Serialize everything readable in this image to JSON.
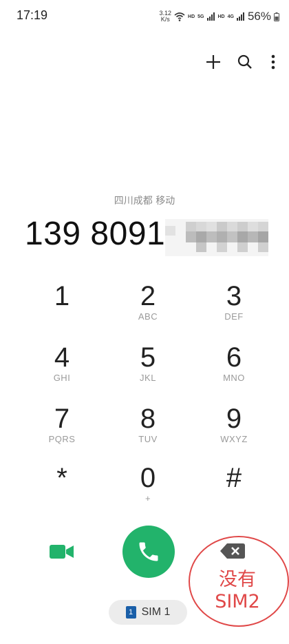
{
  "status_bar": {
    "time": "17:19",
    "speed_value": "3.12",
    "speed_unit": "K/s",
    "hd1": "HD",
    "net5g": "5G",
    "hd2": "HD",
    "net4g": "4G",
    "battery": "56%"
  },
  "toolbar": {
    "add_icon": "plus-icon",
    "search_icon": "search-icon",
    "more_icon": "more-vertical-icon"
  },
  "carrier_info": "四川成都 移动",
  "dialed_number": "139 8091",
  "keypad": [
    {
      "digit": "1",
      "letters": ""
    },
    {
      "digit": "2",
      "letters": "ABC"
    },
    {
      "digit": "3",
      "letters": "DEF"
    },
    {
      "digit": "4",
      "letters": "GHI"
    },
    {
      "digit": "5",
      "letters": "JKL"
    },
    {
      "digit": "6",
      "letters": "MNO"
    },
    {
      "digit": "7",
      "letters": "PQRS"
    },
    {
      "digit": "8",
      "letters": "TUV"
    },
    {
      "digit": "9",
      "letters": "WXYZ"
    },
    {
      "digit": "*",
      "letters": ""
    },
    {
      "digit": "0",
      "letters": "+"
    },
    {
      "digit": "#",
      "letters": ""
    }
  ],
  "sim": {
    "chip": "1",
    "label": "SIM 1"
  },
  "annotation": {
    "line1": "没有",
    "line2": "SIM2"
  },
  "colors": {
    "call_green": "#22b36b",
    "annotation_red": "#e04848",
    "sim_blue": "#1a5fa8"
  }
}
